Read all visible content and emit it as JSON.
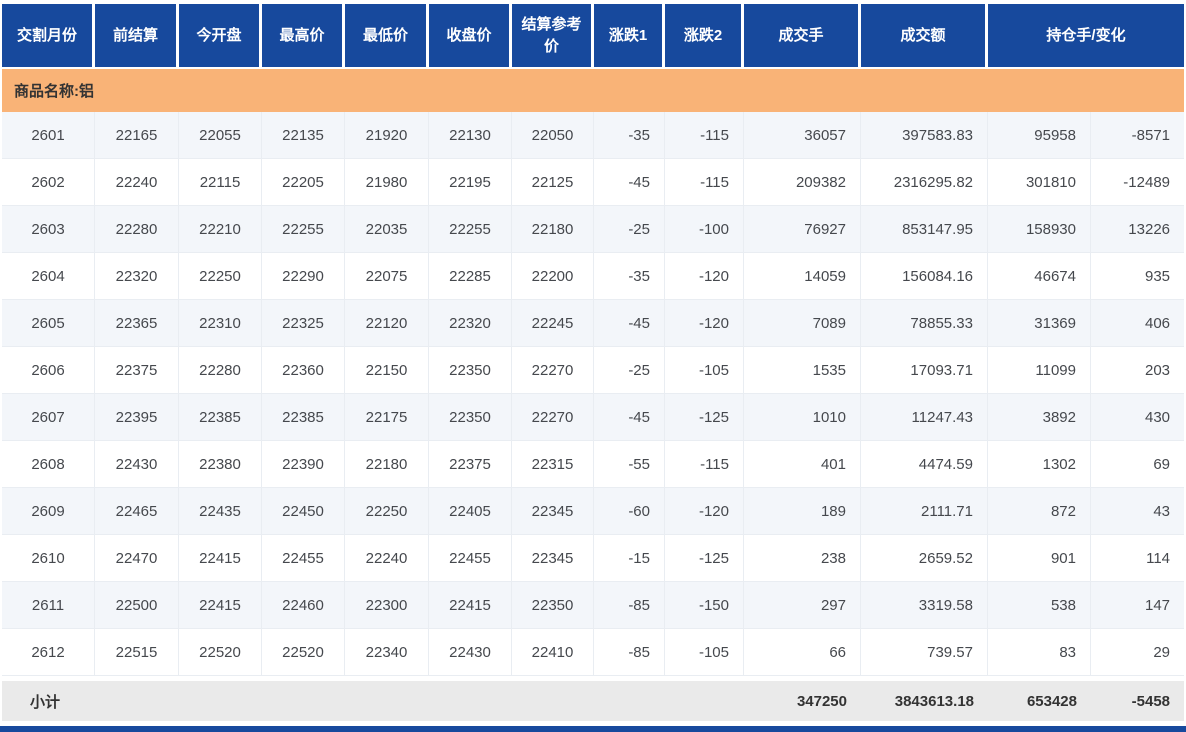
{
  "columns": [
    "交割月份",
    "前结算",
    "今开盘",
    "最高价",
    "最低价",
    "收盘价",
    "结算参考价",
    "涨跌1",
    "涨跌2",
    "成交手",
    "成交额",
    "持仓手/变化"
  ],
  "commodity_label": "商品名称:铝",
  "rows": [
    {
      "month": "2601",
      "prev_settle": "22165",
      "open": "22055",
      "high": "22135",
      "low": "21920",
      "close": "22130",
      "settle_ref": "22050",
      "change1": "-35",
      "change2": "-115",
      "volume": "36057",
      "turnover": "397583.83",
      "open_interest": "95958",
      "oi_change": "-8571"
    },
    {
      "month": "2602",
      "prev_settle": "22240",
      "open": "22115",
      "high": "22205",
      "low": "21980",
      "close": "22195",
      "settle_ref": "22125",
      "change1": "-45",
      "change2": "-115",
      "volume": "209382",
      "turnover": "2316295.82",
      "open_interest": "301810",
      "oi_change": "-12489"
    },
    {
      "month": "2603",
      "prev_settle": "22280",
      "open": "22210",
      "high": "22255",
      "low": "22035",
      "close": "22255",
      "settle_ref": "22180",
      "change1": "-25",
      "change2": "-100",
      "volume": "76927",
      "turnover": "853147.95",
      "open_interest": "158930",
      "oi_change": "13226"
    },
    {
      "month": "2604",
      "prev_settle": "22320",
      "open": "22250",
      "high": "22290",
      "low": "22075",
      "close": "22285",
      "settle_ref": "22200",
      "change1": "-35",
      "change2": "-120",
      "volume": "14059",
      "turnover": "156084.16",
      "open_interest": "46674",
      "oi_change": "935"
    },
    {
      "month": "2605",
      "prev_settle": "22365",
      "open": "22310",
      "high": "22325",
      "low": "22120",
      "close": "22320",
      "settle_ref": "22245",
      "change1": "-45",
      "change2": "-120",
      "volume": "7089",
      "turnover": "78855.33",
      "open_interest": "31369",
      "oi_change": "406"
    },
    {
      "month": "2606",
      "prev_settle": "22375",
      "open": "22280",
      "high": "22360",
      "low": "22150",
      "close": "22350",
      "settle_ref": "22270",
      "change1": "-25",
      "change2": "-105",
      "volume": "1535",
      "turnover": "17093.71",
      "open_interest": "11099",
      "oi_change": "203"
    },
    {
      "month": "2607",
      "prev_settle": "22395",
      "open": "22385",
      "high": "22385",
      "low": "22175",
      "close": "22350",
      "settle_ref": "22270",
      "change1": "-45",
      "change2": "-125",
      "volume": "1010",
      "turnover": "11247.43",
      "open_interest": "3892",
      "oi_change": "430"
    },
    {
      "month": "2608",
      "prev_settle": "22430",
      "open": "22380",
      "high": "22390",
      "low": "22180",
      "close": "22375",
      "settle_ref": "22315",
      "change1": "-55",
      "change2": "-115",
      "volume": "401",
      "turnover": "4474.59",
      "open_interest": "1302",
      "oi_change": "69"
    },
    {
      "month": "2609",
      "prev_settle": "22465",
      "open": "22435",
      "high": "22450",
      "low": "22250",
      "close": "22405",
      "settle_ref": "22345",
      "change1": "-60",
      "change2": "-120",
      "volume": "189",
      "turnover": "2111.71",
      "open_interest": "872",
      "oi_change": "43"
    },
    {
      "month": "2610",
      "prev_settle": "22470",
      "open": "22415",
      "high": "22455",
      "low": "22240",
      "close": "22455",
      "settle_ref": "22345",
      "change1": "-15",
      "change2": "-125",
      "volume": "238",
      "turnover": "2659.52",
      "open_interest": "901",
      "oi_change": "114"
    },
    {
      "month": "2611",
      "prev_settle": "22500",
      "open": "22415",
      "high": "22460",
      "low": "22300",
      "close": "22415",
      "settle_ref": "22350",
      "change1": "-85",
      "change2": "-150",
      "volume": "297",
      "turnover": "3319.58",
      "open_interest": "538",
      "oi_change": "147"
    },
    {
      "month": "2612",
      "prev_settle": "22515",
      "open": "22520",
      "high": "22520",
      "low": "22340",
      "close": "22430",
      "settle_ref": "22410",
      "change1": "-85",
      "change2": "-105",
      "volume": "66",
      "turnover": "739.57",
      "open_interest": "83",
      "oi_change": "29"
    }
  ],
  "subtotal": {
    "label": "小计",
    "volume": "347250",
    "turnover": "3843613.18",
    "open_interest": "653428",
    "oi_change": "-5458"
  },
  "colors": {
    "header_bg": "#17499D",
    "commodity_bg": "#F9B377",
    "row_alt_bg": "#F3F6FA",
    "subtotal_bg": "#EAEAEA",
    "bottom_bar": "#17499D"
  }
}
